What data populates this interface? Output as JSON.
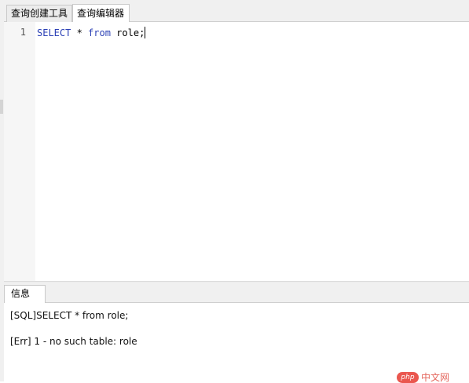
{
  "tabs": [
    {
      "label": "查询创建工具",
      "active": false
    },
    {
      "label": "查询编辑器",
      "active": true
    }
  ],
  "editor": {
    "line_number": "1",
    "code": {
      "keyword1": "SELECT",
      "part1": " * ",
      "keyword2": "from",
      "part2": " role;"
    }
  },
  "bottom_panel": {
    "tab_label": "信息",
    "messages": [
      "[SQL]SELECT * from role;",
      "[Err] 1 - no such table: role"
    ]
  },
  "watermark": {
    "logo_text": "php",
    "text": "中文网"
  },
  "colors": {
    "keyword": "#2a3fb5",
    "watermark": "#e8453c"
  }
}
